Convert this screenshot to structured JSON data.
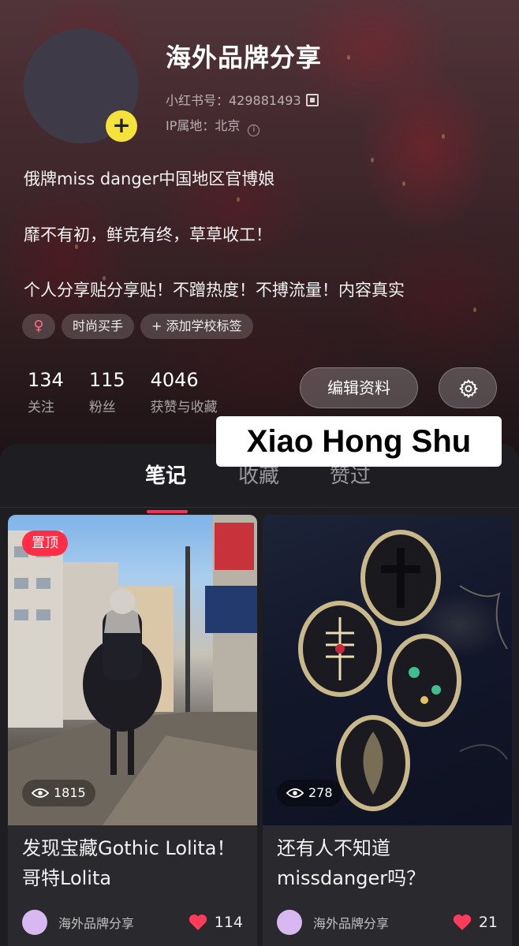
{
  "profile": {
    "nickname": "海外品牌分享",
    "id_text": "小红书号：429881493",
    "ip_text": "IP属地：北京",
    "add_symbol": "+"
  },
  "bio": [
    "俄牌miss danger中国地区官博娘",
    "靡不有初，鲜克有终，草草收工！",
    "个人分享贴分享贴！不蹭热度！不搏流量！内容真实"
  ],
  "tags": {
    "gender_symbol": "♀",
    "items": [
      "时尚买手",
      "+ 添加学校标签"
    ]
  },
  "stats": [
    {
      "value": "134",
      "label": "关注"
    },
    {
      "value": "115",
      "label": "粉丝"
    },
    {
      "value": "4046",
      "label": "获赞与收藏"
    }
  ],
  "actions": {
    "edit_label": "编辑资料",
    "settings_icon": "gear-icon"
  },
  "watermark": "Xiao Hong Shu",
  "tabs": [
    "笔记",
    "收藏",
    "赞过"
  ],
  "notes": [
    {
      "pinned_label": "置顶",
      "views": "1815",
      "title": "发现宝藏Gothic Lolita！哥特Lolita",
      "author": "海外品牌分享",
      "likes": "114"
    },
    {
      "views": "278",
      "title": "还有人不知道missdanger吗？",
      "author": "海外品牌分享",
      "likes": "21"
    }
  ],
  "colors": {
    "accent": "#ff2d55",
    "add_button": "#f5e23a",
    "pin_badge": "#ff2d46",
    "heart": "#ff3b5c",
    "panel_bg": "#1e1d22"
  }
}
